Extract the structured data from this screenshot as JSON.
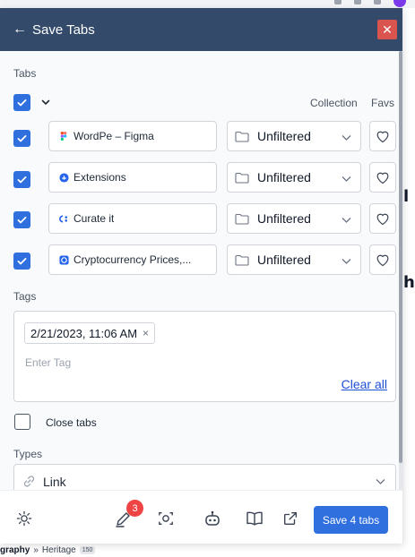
{
  "header": {
    "back_arrow": "←",
    "title": "Save Tabs",
    "close_glyph": "✕"
  },
  "tabs_section": {
    "label": "Tabs",
    "collection_header": "Collection",
    "favs_header": "Favs",
    "items": [
      {
        "favicon": "figma-icon",
        "title": "WordPe – Figma",
        "collection": "Unfiltered"
      },
      {
        "favicon": "extensions-icon",
        "title": "Extensions",
        "collection": "Unfiltered"
      },
      {
        "favicon": "curateit-icon",
        "title": "Curate it",
        "collection": "Unfiltered"
      },
      {
        "favicon": "crypto-icon",
        "title": "Cryptocurrency Prices,...",
        "collection": "Unfiltered"
      }
    ]
  },
  "tags_section": {
    "label": "Tags",
    "chips": [
      {
        "text": "2/21/2023, 11:06 AM",
        "remove": "×"
      }
    ],
    "placeholder": "Enter Tag",
    "clear_all": "Clear all"
  },
  "close_tabs": {
    "label": "Close tabs",
    "checked": false
  },
  "types_section": {
    "label": "Types",
    "value": "Link",
    "icon": "link-icon"
  },
  "footer": {
    "notification_count": "3",
    "save_button": "Save 4 tabs",
    "icons": [
      "sun-icon",
      "pen-icon",
      "camera-scan-icon",
      "robot-icon",
      "book-icon",
      "external-link-icon"
    ]
  },
  "background": {
    "breadcrumb_bold": "graphy",
    "breadcrumb_sep": "»",
    "breadcrumb_item": "Heritage",
    "breadcrumb_count": "150"
  },
  "colors": {
    "header": "#334a6b",
    "accent": "#2f6fde",
    "close": "#d9534f",
    "badge": "#ef4444"
  }
}
